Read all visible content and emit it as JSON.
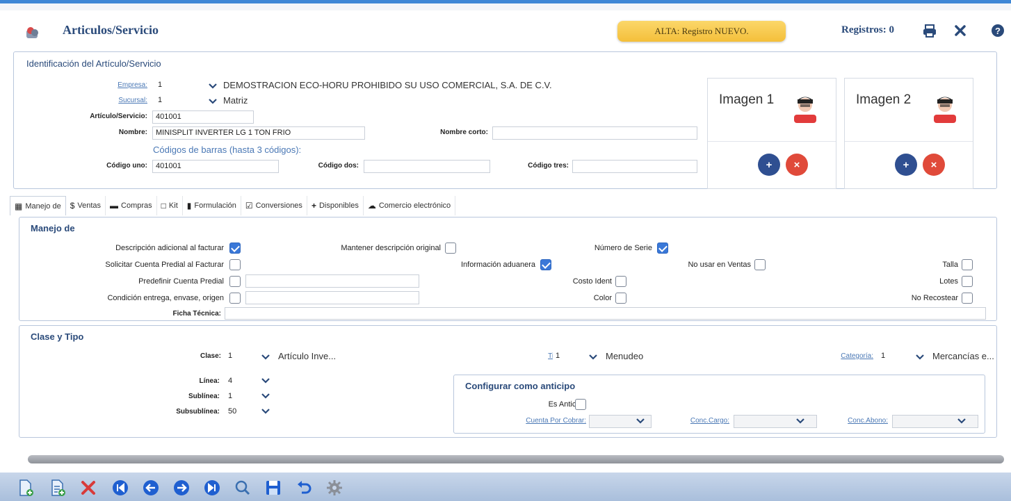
{
  "header": {
    "title": "Articulos/Servicio",
    "status": "ALTA: Registro NUEVO.",
    "registros": "Registros: 0",
    "icons": [
      "app-icon",
      "print-icon",
      "close-icon",
      "help-icon"
    ]
  },
  "identificacion": {
    "title": "Identificación del Artículo/Servicio",
    "empresa_label": "Empresa:",
    "empresa_value": "1",
    "empresa_name": "DEMOSTRACION ECO-HORU PROHIBIDO SU USO COMERCIAL, S.A. DE C.V.",
    "sucursal_label": "Sucursal:",
    "sucursal_value": "1",
    "sucursal_name": "Matriz",
    "articulo_label": "Artículo/Servicio:",
    "articulo_value": "401001",
    "nombre_label": "Nombre:",
    "nombre_value": "MINISPLIT INVERTER LG 1 TON FRIO",
    "nombre_corto_label": "Nombre corto:",
    "nombre_corto_value": "",
    "codigos_heading": "Códigos de barras (hasta 3 códigos):",
    "codigo_uno_label": "Código uno:",
    "codigo_uno_value": "401001",
    "codigo_dos_label": "Código dos:",
    "codigo_dos_value": "",
    "codigo_tres_label": "Código tres:",
    "codigo_tres_value": "",
    "imagen1": "Imagen 1",
    "imagen2": "Imagen 2"
  },
  "tabs": [
    {
      "label": "Manejo de",
      "icon": "building-icon"
    },
    {
      "label": "Ventas",
      "icon": "dollar-icon"
    },
    {
      "label": "Compras",
      "icon": "money-icon"
    },
    {
      "label": "Kit",
      "icon": "sitemap-icon"
    },
    {
      "label": "Formulación",
      "icon": "clipboard-icon"
    },
    {
      "label": "Conversiones",
      "icon": "clipboard-check-icon"
    },
    {
      "label": "Disponibles",
      "icon": "plus-icon"
    },
    {
      "label": "Comercio electrónico",
      "icon": "cloud-icon"
    }
  ],
  "manejo": {
    "title": "Manejo de",
    "descripcion_adicional": "Descripción adicional al facturar",
    "mantener_descripcion": "Mantener descripción original",
    "numero_serie": "Número de Serie",
    "solicitar_cuenta": "Solicitar Cuenta Predial al Facturar",
    "info_aduanera": "Información aduanera",
    "no_usar_ventas": "No usar en Ventas",
    "talla": "Talla",
    "predefinir_cuenta": "Predefinir Cuenta Predial",
    "costo_ident": "Costo Ident",
    "lotes": "Lotes",
    "condicion_entrega": "Condición entrega, envase, origen",
    "color": "Color",
    "no_recostear": "No Recostear",
    "ficha_tecnica": "Ficha Técnica:",
    "checks": {
      "descripcion_adicional": true,
      "mantener_descripcion": false,
      "numero_serie": true,
      "solicitar_cuenta": false,
      "info_aduanera": true,
      "no_usar_ventas": false,
      "talla": false,
      "predefinir_cuenta": false,
      "costo_ident": false,
      "lotes": false,
      "condicion_entrega": false,
      "color": false,
      "no_recostear": false
    }
  },
  "clase_tipo": {
    "title": "Clase y Tipo",
    "clase_label": "Clase:",
    "clase_value": "1",
    "clase_name": "Artículo Inve...",
    "tipo_label": "Tipo:",
    "tipo_value": "1",
    "tipo_name": "Menudeo",
    "categoria_label": "Categoría:",
    "categoria_value": "1",
    "categoria_name": "Mercancías e...",
    "linea_label": "Línea:",
    "linea_value": "4",
    "sublinea_label": "Sublínea:",
    "sublinea_value": "1",
    "subsublinea_label": "Subsublínea:",
    "subsublinea_value": "50",
    "anticipo_title": "Configurar como anticipo",
    "es_anticipo": "Es Anticipo",
    "cuenta_cobrar": "Cuenta Por Cobrar:",
    "conc_cargo": "Conc.Cargo:",
    "conc_abono": "Conc.Abono:"
  },
  "toolbar": [
    "new-doc-icon",
    "copy-doc-icon",
    "delete-icon",
    "first-icon",
    "prev-icon",
    "next-icon",
    "last-icon",
    "search-icon",
    "save-icon",
    "undo-icon",
    "settings-icon"
  ],
  "colors": {
    "accent": "#3f88d6",
    "title": "#2a4a7a",
    "status": "#f4bf3a",
    "add": "#2f4f91",
    "remove": "#e04a3a"
  }
}
